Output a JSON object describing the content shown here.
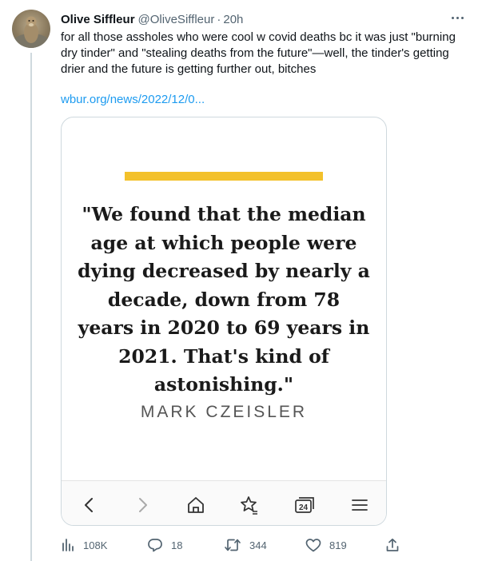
{
  "tweet": {
    "author_name": "Olive Siffleur",
    "handle": "@OliveSiffleur",
    "separator": "·",
    "time": "20h",
    "text": "for all those assholes who were cool w covid deaths bc it was just \"burning dry tinder\" and \"stealing deaths from the future\"—well, the tinder's getting drier and the future is getting further out, bitches",
    "link_text": "wbur.org/news/2022/12/0..."
  },
  "card": {
    "quote_lines": [
      "\"We found that the median",
      "age at which people were",
      "dying decreased by nearly a",
      "decade, down from 78",
      "years in 2020 to 69 years in",
      "2021. That's kind of",
      "astonishing.\""
    ],
    "attribution": "MARK CZEISLER",
    "accent_color": "#f3c12b",
    "tab_count": "24"
  },
  "actions": {
    "views": "108K",
    "replies": "18",
    "retweets": "344",
    "likes": "819"
  },
  "colors": {
    "text": "#0f1419",
    "secondary": "#536471",
    "link": "#1d9bf0",
    "border": "#cfd9de"
  }
}
